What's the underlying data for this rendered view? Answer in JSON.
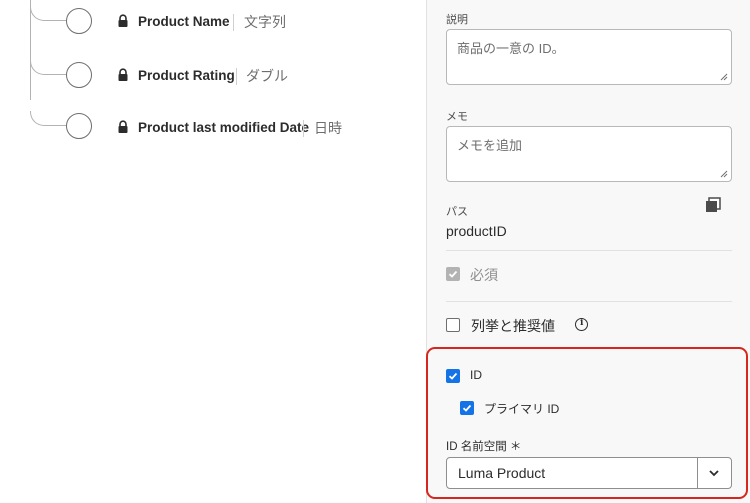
{
  "tree": {
    "fields": [
      {
        "name": "Product Name",
        "type": "文字列"
      },
      {
        "name": "Product Rating",
        "type": "ダブル"
      },
      {
        "name": "Product last modified Date",
        "type": "日時"
      }
    ]
  },
  "panel": {
    "description_label": "説明",
    "description_value": "商品の一意の ID。",
    "memo_label": "メモ",
    "memo_placeholder": "メモを追加",
    "path_label": "パス",
    "path_value": "productID",
    "required_label": "必須",
    "required_checked": true,
    "enum_label": "列挙と推奨値",
    "enum_checked": false,
    "identity_label": "ID",
    "identity_checked": true,
    "primary_id_label": "プライマリ ID",
    "primary_id_checked": true,
    "namespace_label": "ID 名前空間 ＊",
    "namespace_value": "Luma Product"
  },
  "colors": {
    "accent": "#1473e6",
    "highlight": "#d7261e"
  },
  "icons": [
    "lock-icon",
    "copy-icon",
    "info-icon",
    "checkmark-icon",
    "chevron-down-icon",
    "resize-grip-icon"
  ]
}
